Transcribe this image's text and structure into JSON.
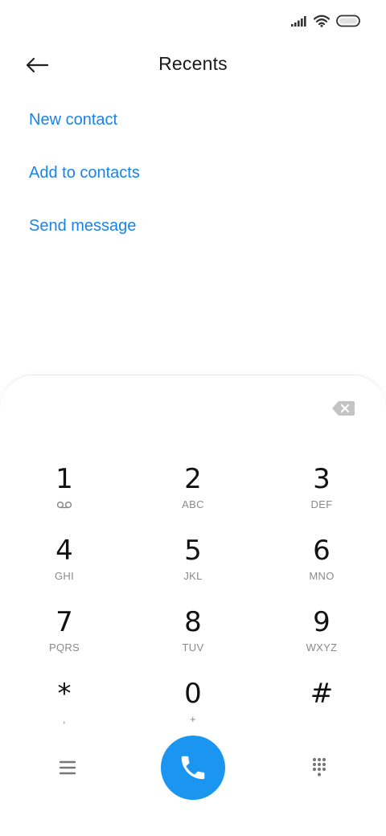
{
  "header": {
    "title": "Recents"
  },
  "actions": [
    {
      "label": "New contact"
    },
    {
      "label": "Add to contacts"
    },
    {
      "label": "Send message"
    }
  ],
  "dialpad": {
    "keys": [
      {
        "digit": "1",
        "letters": "",
        "icon": "voicemail-icon"
      },
      {
        "digit": "2",
        "letters": "ABC"
      },
      {
        "digit": "3",
        "letters": "DEF"
      },
      {
        "digit": "4",
        "letters": "GHI"
      },
      {
        "digit": "5",
        "letters": "JKL"
      },
      {
        "digit": "6",
        "letters": "MNO"
      },
      {
        "digit": "7",
        "letters": "PQRS"
      },
      {
        "digit": "8",
        "letters": "TUV"
      },
      {
        "digit": "9",
        "letters": "WXYZ"
      },
      {
        "digit": "*",
        "letters": ","
      },
      {
        "digit": "0",
        "letters": "+"
      },
      {
        "digit": "#",
        "letters": ""
      }
    ]
  },
  "colors": {
    "accent": "#1883e8",
    "call_button": "#1b96f0",
    "text_primary": "#111111",
    "text_secondary": "#8a8a8a"
  },
  "icons": {
    "back": "arrow-left-icon",
    "backspace": "backspace-icon",
    "menu": "menu-icon",
    "call": "phone-icon",
    "keypad": "dialpad-icon",
    "signal": "signal-icon",
    "wifi": "wifi-icon",
    "battery": "battery-icon"
  }
}
